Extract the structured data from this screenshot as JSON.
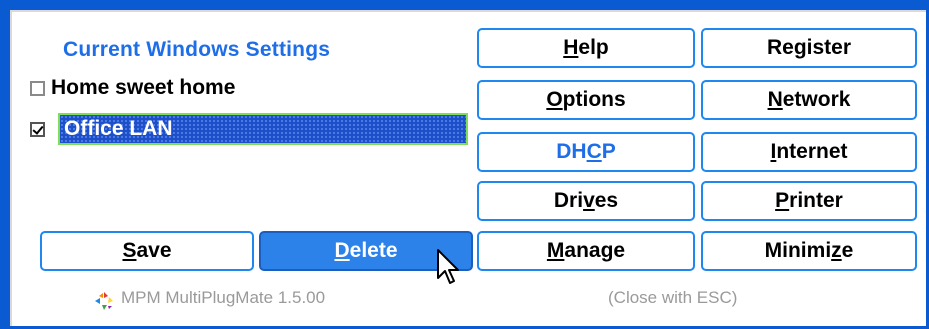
{
  "panel": {
    "title": "Current Windows Settings",
    "items": [
      {
        "label": "Home sweet home",
        "checked": false,
        "selected": false
      },
      {
        "label": "Office LAN",
        "checked": true,
        "selected": true
      }
    ]
  },
  "buttons": {
    "help": {
      "pre": "",
      "u": "H",
      "post": "elp"
    },
    "register": {
      "label": "Register"
    },
    "options": {
      "pre": "",
      "u": "O",
      "post": "ptions"
    },
    "network": {
      "pre": "",
      "u": "N",
      "post": "etwork"
    },
    "dhcp": {
      "pre": "DH",
      "u": "C",
      "post": "P"
    },
    "internet": {
      "pre": "",
      "u": "I",
      "post": "nternet"
    },
    "drives": {
      "pre": "Dri",
      "u": "v",
      "post": "es"
    },
    "printer": {
      "pre": "",
      "u": "P",
      "post": "rinter"
    },
    "save": {
      "pre": "",
      "u": "S",
      "post": "ave"
    },
    "delete": {
      "pre": "",
      "u": "D",
      "post": "elete"
    },
    "manage": {
      "pre": "",
      "u": "M",
      "post": "anage"
    },
    "minimize": {
      "pre": "Minimi",
      "u": "z",
      "post": "e"
    }
  },
  "footer": {
    "app_name": "MPM MultiPlugMate 1.5.00",
    "hint": "(Close with ESC)"
  },
  "colors": {
    "accent": "#1e6ee8",
    "button_border": "#1e87f0",
    "selection": "#1c4fc8",
    "window_frame": "#0a5ad2"
  },
  "icons": [
    "logo-icon",
    "mouse-cursor-icon"
  ]
}
